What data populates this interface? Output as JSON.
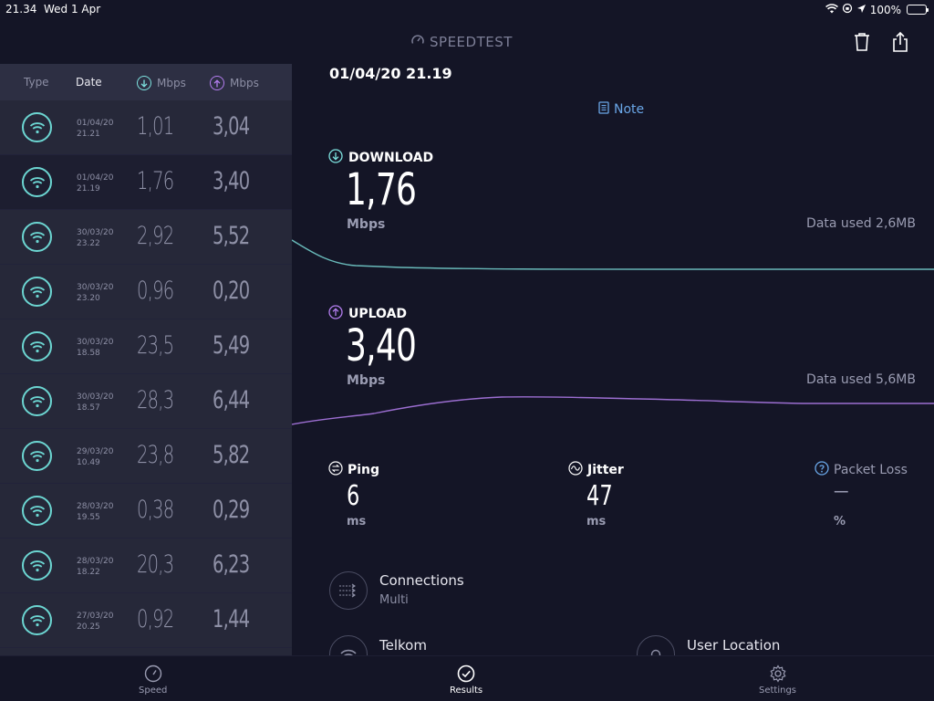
{
  "status_bar": {
    "time": "21.34",
    "date": "Wed 1 Apr",
    "battery": "100%"
  },
  "app": {
    "title": "SPEEDTEST"
  },
  "list": {
    "headers": {
      "type": "Type",
      "date": "Date",
      "download": "Mbps",
      "upload": "Mbps"
    },
    "rows": [
      {
        "date": "01/04/20",
        "time": "21.21",
        "download": "1,01",
        "upload": "3,04"
      },
      {
        "date": "01/04/20",
        "time": "21.19",
        "download": "1,76",
        "upload": "3,40"
      },
      {
        "date": "30/03/20",
        "time": "23.22",
        "download": "2,92",
        "upload": "5,52"
      },
      {
        "date": "30/03/20",
        "time": "23.20",
        "download": "0,96",
        "upload": "0,20"
      },
      {
        "date": "30/03/20",
        "time": "18.58",
        "download": "23,5",
        "upload": "5,49"
      },
      {
        "date": "30/03/20",
        "time": "18.57",
        "download": "28,3",
        "upload": "6,44"
      },
      {
        "date": "29/03/20",
        "time": "10.49",
        "download": "23,8",
        "upload": "5,82"
      },
      {
        "date": "28/03/20",
        "time": "19.55",
        "download": "0,38",
        "upload": "0,29"
      },
      {
        "date": "28/03/20",
        "time": "18.22",
        "download": "20,3",
        "upload": "6,23"
      },
      {
        "date": "27/03/20",
        "time": "20.25",
        "download": "0,92",
        "upload": "1,44"
      }
    ]
  },
  "detail": {
    "datetime": "01/04/20 21.19",
    "note_label": "Note",
    "download": {
      "label": "DOWNLOAD",
      "value": "1,76",
      "unit": "Mbps",
      "data_used": "Data used 2,6MB"
    },
    "upload": {
      "label": "UPLOAD",
      "value": "3,40",
      "unit": "Mbps",
      "data_used": "Data used 5,6MB"
    },
    "ping": {
      "label": "Ping",
      "value": "6",
      "unit": "ms"
    },
    "jitter": {
      "label": "Jitter",
      "value": "47",
      "unit": "ms"
    },
    "packet_loss": {
      "label": "Packet Loss",
      "value": "—",
      "unit": "%"
    },
    "connections": {
      "title": "Connections",
      "value": "Multi"
    },
    "provider": {
      "title": "Telkom"
    },
    "user_location": {
      "title": "User Location"
    }
  },
  "tabs": [
    {
      "label": "Speed"
    },
    {
      "label": "Results"
    },
    {
      "label": "Settings"
    }
  ],
  "colors": {
    "background": "#141526",
    "panel": "#262839",
    "download_accent": "#7ee3e0",
    "upload_accent": "#b47ef0",
    "note_link": "#6aa7e8"
  }
}
